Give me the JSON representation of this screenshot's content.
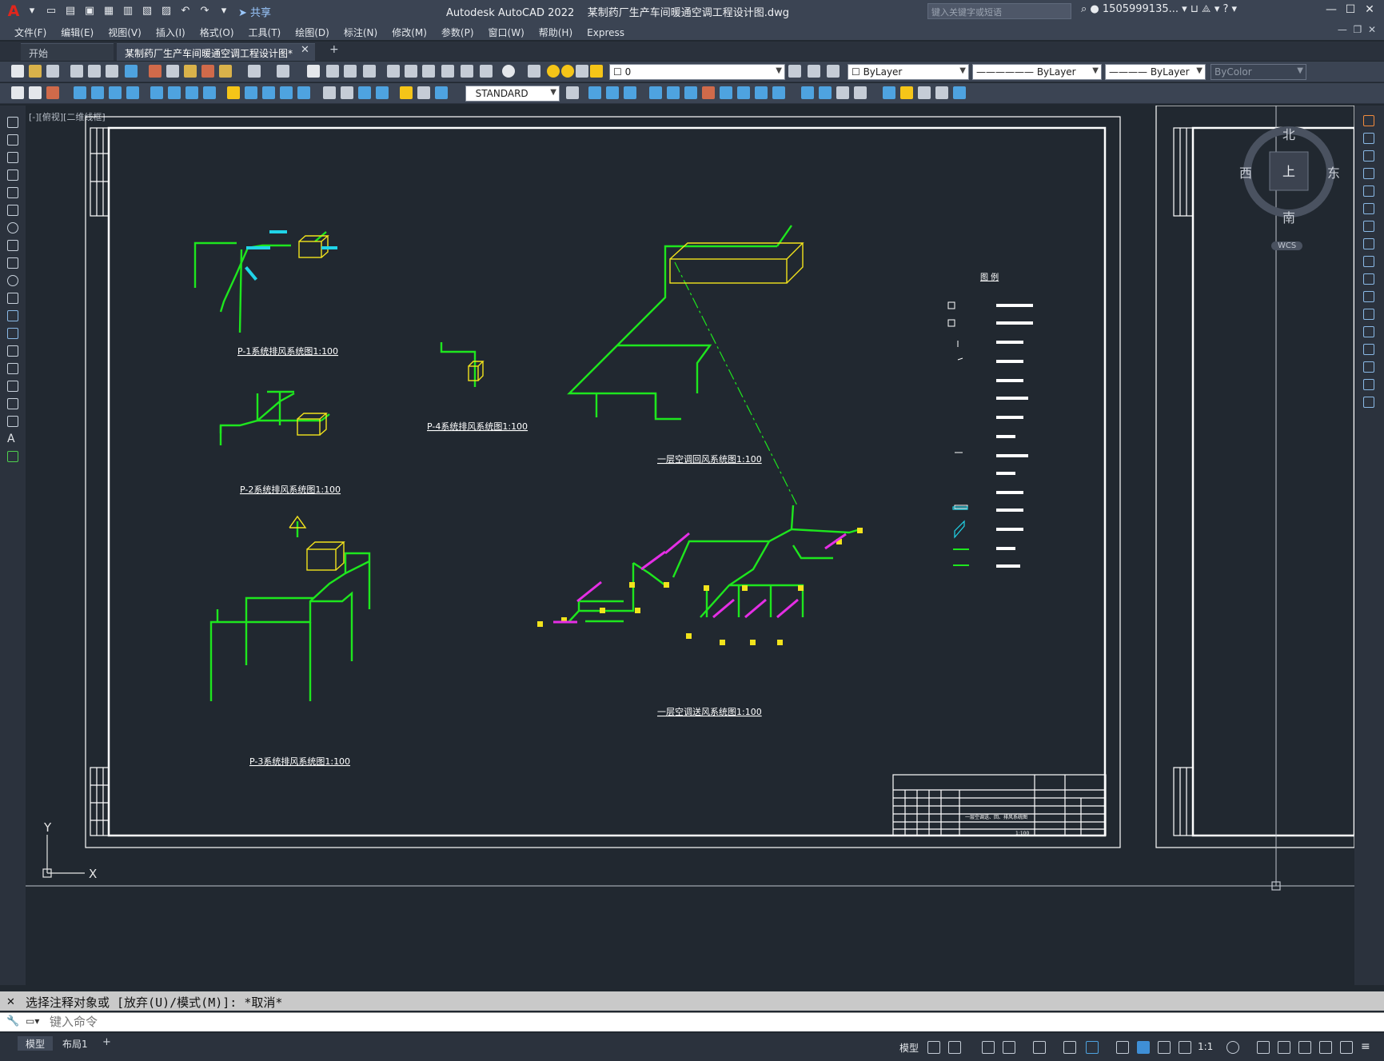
{
  "app": {
    "title": "Autodesk AutoCAD 2022",
    "file_name": "某制药厂生产车间暖通空调工程设计图.dwg",
    "share_label": "共享",
    "search_placeholder": "键入关键字或短语",
    "user": "1505999135..."
  },
  "menu": [
    "文件(F)",
    "编辑(E)",
    "视图(V)",
    "插入(I)",
    "格式(O)",
    "工具(T)",
    "绘图(D)",
    "标注(N)",
    "修改(M)",
    "参数(P)",
    "窗口(W)",
    "帮助(H)",
    "Express"
  ],
  "tabs": {
    "start": "开始",
    "document": "某制药厂生产车间暖通空调工程设计图*"
  },
  "toolbar": {
    "layer": "0",
    "color": "ByLayer",
    "linetype": "ByLayer",
    "lineweight": "ByLayer",
    "plotstyle": "ByColor",
    "text_style": "STANDARD"
  },
  "viewport": {
    "label": "[-][俯视][二维线框]",
    "compass": {
      "north": "北",
      "south": "南",
      "east": "东",
      "west": "西",
      "top": "上",
      "wcs": "WCS"
    },
    "ucs": {
      "x": "X",
      "y": "Y"
    }
  },
  "drawing": {
    "titles": {
      "p1": "P-1系统排风系统图1:100",
      "p2": "P-2系统排风系统图1:100",
      "p3": "P-3系统排风系统图1:100",
      "p4": "P-4系统排风系统图1:100",
      "return": "一层空调回风系统图1:100",
      "supply": "一层空调送风系统图1:100"
    },
    "legend_title": "图 例",
    "title_block": {
      "scale": "1:100",
      "drawing_name": "一层空调送、回、排风系统图"
    }
  },
  "command": {
    "history": "选择注释对象或 [放弃(U)/模式(M)]: *取消*",
    "placeholder": "键入命令"
  },
  "status": {
    "layout_tabs": [
      "模型",
      "布局1"
    ],
    "model": "模型",
    "scale": "1:1"
  },
  "colors": {
    "duct_green": "#1ee61e",
    "equipment_yellow": "#f2e31c",
    "dimension_cyan": "#20d4e8",
    "tag_magenta": "#e52ee5",
    "frame_white": "#ffffff",
    "canvas": "#212830"
  }
}
